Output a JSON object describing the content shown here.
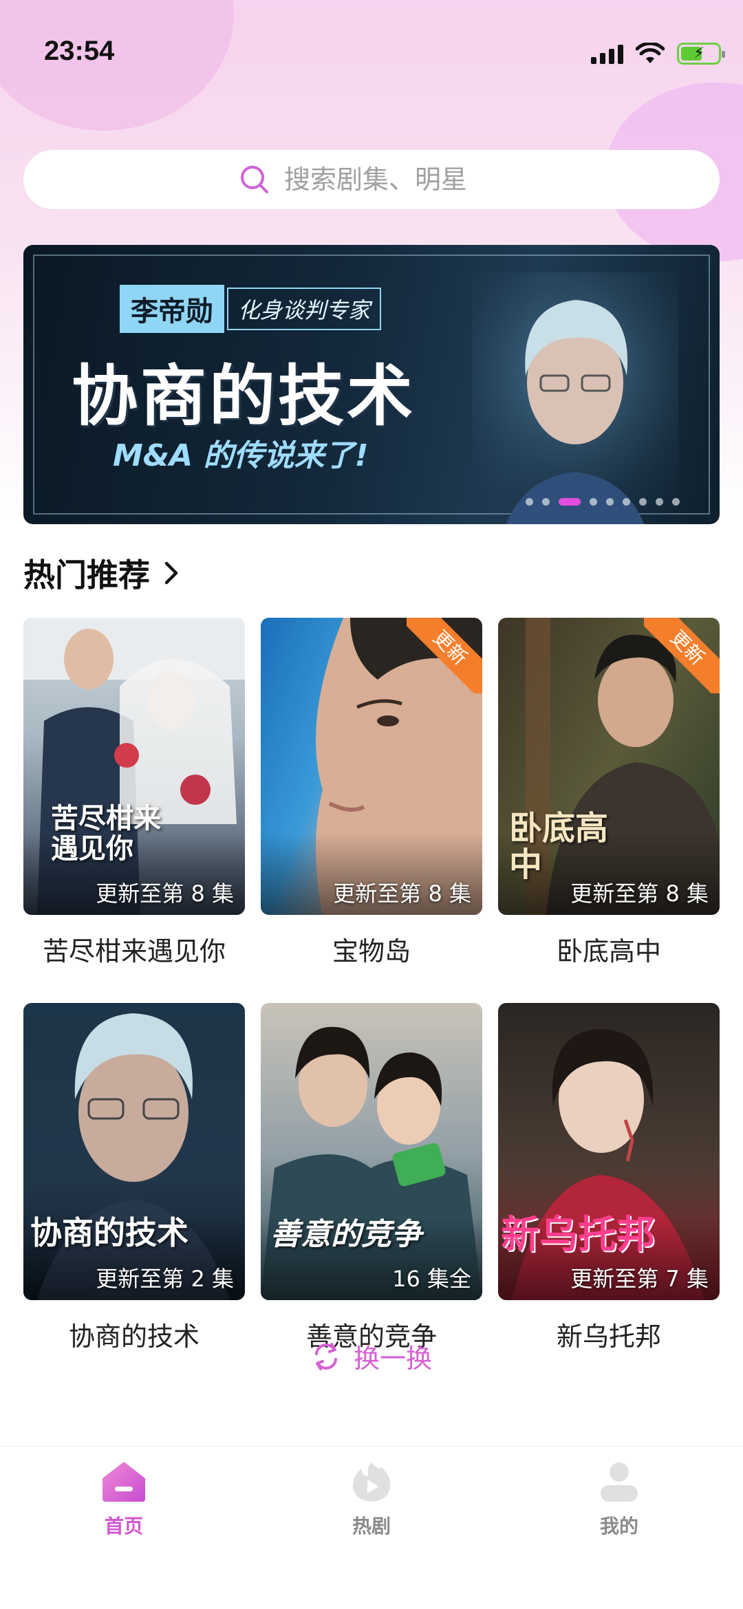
{
  "status_bar": {
    "time": "23:54"
  },
  "search": {
    "placeholder": "搜索剧集、明星"
  },
  "banner": {
    "tag_name": "李帝勋",
    "tag_desc": "化身谈判专家",
    "title": "协商的技术",
    "subtitle": "M&A 的传说来了!",
    "slide_count": 10,
    "active_slide": 2
  },
  "section": {
    "title": "热门推荐"
  },
  "shows": [
    {
      "title": "苦尽柑来遇见你",
      "episode": "更新至第 8 集",
      "poster_text": "苦尽柑来遇见你",
      "badge": ""
    },
    {
      "title": "宝物岛",
      "episode": "更新至第 8 集",
      "poster_text": "",
      "badge": "更新"
    },
    {
      "title": "卧底高中",
      "episode": "更新至第 8 集",
      "poster_text": "卧底高中",
      "badge": "更新"
    },
    {
      "title": "协商的技术",
      "episode": "更新至第 2 集",
      "poster_text": "协商的技术",
      "badge": ""
    },
    {
      "title": "善意的竞争",
      "episode": "16 集全",
      "poster_text": "善意的竞争",
      "badge": ""
    },
    {
      "title": "新乌托邦",
      "episode": "更新至第 7 集",
      "poster_text": "新乌托邦",
      "badge": ""
    }
  ],
  "refresh": {
    "label": "换一换"
  },
  "tabbar": {
    "items": [
      {
        "label": "首页",
        "icon": "home-icon",
        "active": true
      },
      {
        "label": "热剧",
        "icon": "play-flame-icon",
        "active": false
      },
      {
        "label": "我的",
        "icon": "profile-icon",
        "active": false
      }
    ]
  },
  "colors": {
    "accent": "#d156d0",
    "badge": "#f47e2b"
  }
}
